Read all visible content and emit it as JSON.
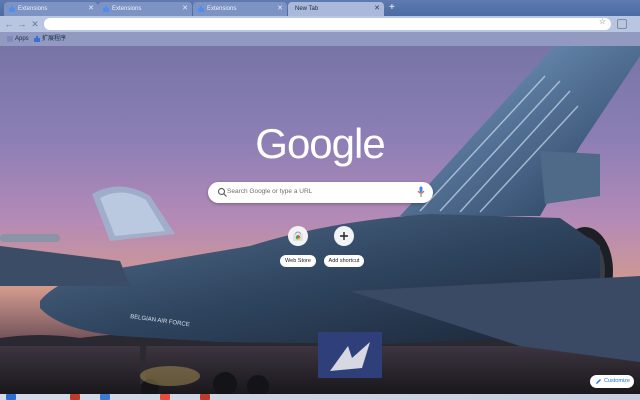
{
  "tabs": [
    {
      "label": "Extensions",
      "active": false
    },
    {
      "label": "Extensions",
      "active": false
    },
    {
      "label": "Extensions",
      "active": false
    },
    {
      "label": "New Tab",
      "active": true
    }
  ],
  "bookmarks": [
    {
      "label": "Apps",
      "icon": "apps-grid-icon"
    },
    {
      "label": "扩展程序",
      "icon": "puzzle-icon"
    }
  ],
  "logo_text": "Google",
  "search": {
    "placeholder": "Search Google or type a URL"
  },
  "shortcuts": [
    {
      "label": "Web Store",
      "icon": "chrome-web-store-icon"
    },
    {
      "label": "Add shortcut",
      "icon": "plus-icon"
    }
  ],
  "customize_label": "Customize",
  "colors": {
    "tabstrip": "#4b6aa3",
    "toolbar": "#b9c6e2",
    "accent": "#1a73e8"
  }
}
